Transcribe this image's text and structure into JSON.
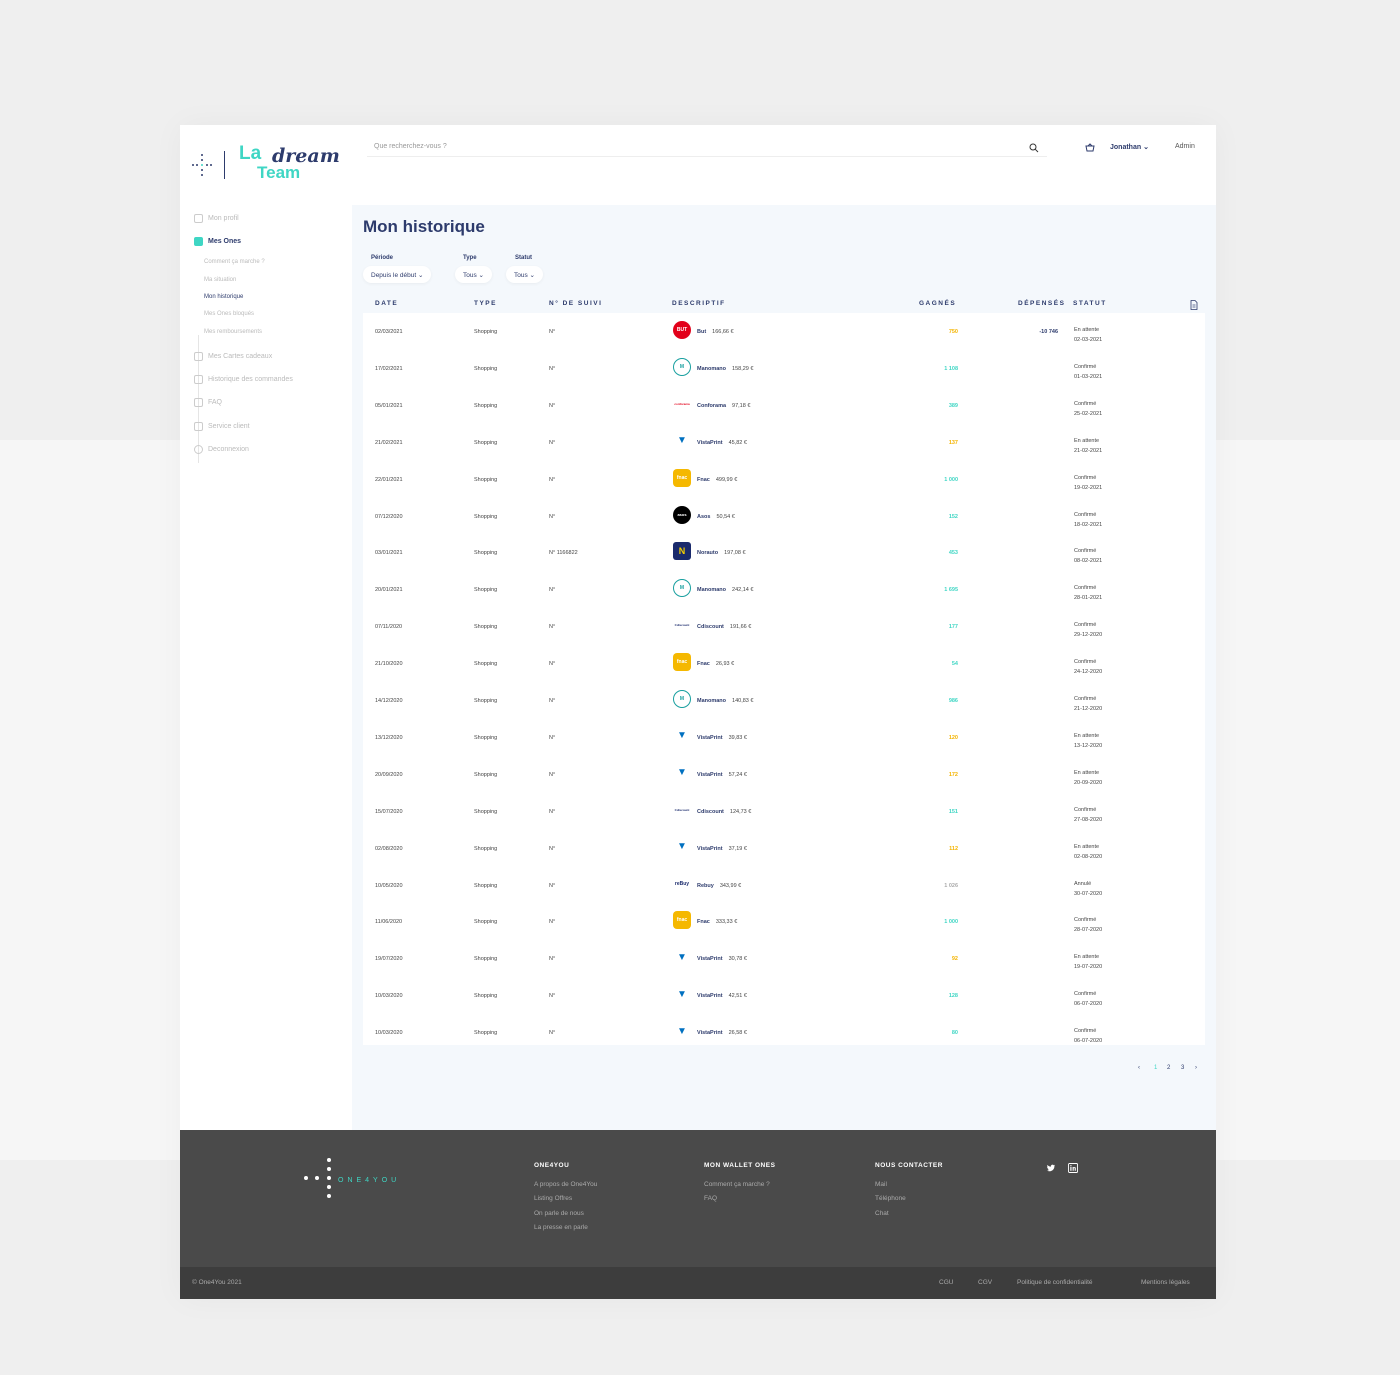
{
  "brand": {
    "la": "La",
    "dream": "dream",
    "team": "Team"
  },
  "header": {
    "search_placeholder": "Que recherchez-vous ?",
    "user": "Jonathan",
    "role": "Admin"
  },
  "sidebar": {
    "items": [
      {
        "label": "Mon profil",
        "icon": "profile-icon"
      },
      {
        "label": "Mes Ones",
        "icon": "coins-icon"
      },
      {
        "label": "Mes Cartes cadeaux",
        "icon": "gift-icon"
      },
      {
        "label": "Historique des commandes",
        "icon": "orders-icon"
      },
      {
        "label": "FAQ",
        "icon": "faq-icon"
      },
      {
        "label": "Service client",
        "icon": "support-icon"
      },
      {
        "label": "Deconnexion",
        "icon": "power-icon"
      }
    ],
    "subitems": [
      "Comment ça marche ?",
      "Ma situation",
      "Mon historique",
      "Mes Ones bloqués",
      "Mes remboursements"
    ]
  },
  "page": {
    "title": "Mon historique"
  },
  "filters": {
    "periode_label": "Période",
    "periode_value": "Depuis le début",
    "type_label": "Type",
    "type_value": "Tous",
    "statut_label": "Statut",
    "statut_value": "Tous"
  },
  "table": {
    "headers": {
      "date": "DATE",
      "type": "TYPE",
      "suivi": "N° DE SUIVI",
      "desc": "DESCRIPTIF",
      "gains": "GAGNÉS",
      "dep": "DÉPENSÉS",
      "statut": "STATUT"
    },
    "rows": [
      {
        "date": "02/03/2021",
        "type": "Shopping",
        "suivi": "N°",
        "merchant": "But",
        "amount": "166,66 €",
        "gain": "750",
        "dep": "-10 746",
        "status": "En attente",
        "sdate": "02-03-2021",
        "logo": "but",
        "gcolor": "#f4b400"
      },
      {
        "date": "17/02/2021",
        "type": "Shopping",
        "suivi": "N°",
        "merchant": "Manomano",
        "amount": "158,29 €",
        "gain": "1 108",
        "dep": "",
        "status": "Confirmé",
        "sdate": "01-03-2021",
        "logo": "mano",
        "gcolor": "#3fd6c4"
      },
      {
        "date": "05/01/2021",
        "type": "Shopping",
        "suivi": "N°",
        "merchant": "Conforama",
        "amount": "97,18 €",
        "gain": "389",
        "dep": "",
        "status": "Confirmé",
        "sdate": "25-02-2021",
        "logo": "confo",
        "gcolor": "#3fd6c4"
      },
      {
        "date": "21/02/2021",
        "type": "Shopping",
        "suivi": "N°",
        "merchant": "VistaPrint",
        "amount": "45,82 €",
        "gain": "137",
        "dep": "",
        "status": "En attente",
        "sdate": "21-02-2021",
        "logo": "vista",
        "gcolor": "#f4b400"
      },
      {
        "date": "22/01/2021",
        "type": "Shopping",
        "suivi": "N°",
        "merchant": "Fnac",
        "amount": "499,99 €",
        "gain": "1 000",
        "dep": "",
        "status": "Confirmé",
        "sdate": "19-02-2021",
        "logo": "fnac",
        "gcolor": "#3fd6c4"
      },
      {
        "date": "07/12/2020",
        "type": "Shopping",
        "suivi": "N°",
        "merchant": "Asos",
        "amount": "50,54 €",
        "gain": "152",
        "dep": "",
        "status": "Confirmé",
        "sdate": "18-02-2021",
        "logo": "asos",
        "gcolor": "#3fd6c4"
      },
      {
        "date": "03/01/2021",
        "type": "Shopping",
        "suivi": "N° 1166822",
        "merchant": "Norauto",
        "amount": "197,08 €",
        "gain": "453",
        "dep": "",
        "status": "Confirmé",
        "sdate": "08-02-2021",
        "logo": "nor",
        "gcolor": "#3fd6c4"
      },
      {
        "date": "20/01/2021",
        "type": "Shopping",
        "suivi": "N°",
        "merchant": "Manomano",
        "amount": "242,14 €",
        "gain": "1 695",
        "dep": "",
        "status": "Confirmé",
        "sdate": "28-01-2021",
        "logo": "mano",
        "gcolor": "#3fd6c4"
      },
      {
        "date": "07/11/2020",
        "type": "Shopping",
        "suivi": "N°",
        "merchant": "Cdiscount",
        "amount": "191,66 €",
        "gain": "177",
        "dep": "",
        "status": "Confirmé",
        "sdate": "29-12-2020",
        "logo": "cdis",
        "gcolor": "#3fd6c4"
      },
      {
        "date": "21/10/2020",
        "type": "Shopping",
        "suivi": "N°",
        "merchant": "Fnac",
        "amount": "26,93 €",
        "gain": "54",
        "dep": "",
        "status": "Confirmé",
        "sdate": "24-12-2020",
        "logo": "fnac",
        "gcolor": "#3fd6c4"
      },
      {
        "date": "14/12/2020",
        "type": "Shopping",
        "suivi": "N°",
        "merchant": "Manomano",
        "amount": "140,83 €",
        "gain": "986",
        "dep": "",
        "status": "Confirmé",
        "sdate": "21-12-2020",
        "logo": "mano",
        "gcolor": "#3fd6c4"
      },
      {
        "date": "13/12/2020",
        "type": "Shopping",
        "suivi": "N°",
        "merchant": "VistaPrint",
        "amount": "39,83 €",
        "gain": "120",
        "dep": "",
        "status": "En attente",
        "sdate": "13-12-2020",
        "logo": "vista",
        "gcolor": "#f4b400"
      },
      {
        "date": "20/09/2020",
        "type": "Shopping",
        "suivi": "N°",
        "merchant": "VistaPrint",
        "amount": "57,24 €",
        "gain": "172",
        "dep": "",
        "status": "En attente",
        "sdate": "20-09-2020",
        "logo": "vista",
        "gcolor": "#f4b400"
      },
      {
        "date": "15/07/2020",
        "type": "Shopping",
        "suivi": "N°",
        "merchant": "Cdiscount",
        "amount": "124,73 €",
        "gain": "151",
        "dep": "",
        "status": "Confirmé",
        "sdate": "27-08-2020",
        "logo": "cdis",
        "gcolor": "#3fd6c4"
      },
      {
        "date": "02/08/2020",
        "type": "Shopping",
        "suivi": "N°",
        "merchant": "VistaPrint",
        "amount": "37,19 €",
        "gain": "112",
        "dep": "",
        "status": "En attente",
        "sdate": "02-08-2020",
        "logo": "vista",
        "gcolor": "#f4b400"
      },
      {
        "date": "10/05/2020",
        "type": "Shopping",
        "suivi": "N°",
        "merchant": "Rebuy",
        "amount": "343,99 €",
        "gain": "1 026",
        "dep": "",
        "status": "Annulé",
        "sdate": "30-07-2020",
        "logo": "rebuy",
        "gcolor": "#aaaaaa"
      },
      {
        "date": "11/06/2020",
        "type": "Shopping",
        "suivi": "N°",
        "merchant": "Fnac",
        "amount": "333,33 €",
        "gain": "1 000",
        "dep": "",
        "status": "Confirmé",
        "sdate": "28-07-2020",
        "logo": "fnac",
        "gcolor": "#3fd6c4"
      },
      {
        "date": "19/07/2020",
        "type": "Shopping",
        "suivi": "N°",
        "merchant": "VistaPrint",
        "amount": "30,78 €",
        "gain": "92",
        "dep": "",
        "status": "En attente",
        "sdate": "19-07-2020",
        "logo": "vista",
        "gcolor": "#f4b400"
      },
      {
        "date": "10/03/2020",
        "type": "Shopping",
        "suivi": "N°",
        "merchant": "VistaPrint",
        "amount": "42,51 €",
        "gain": "128",
        "dep": "",
        "status": "Confirmé",
        "sdate": "06-07-2020",
        "logo": "vista",
        "gcolor": "#3fd6c4"
      },
      {
        "date": "10/03/2020",
        "type": "Shopping",
        "suivi": "N°",
        "merchant": "VistaPrint",
        "amount": "26,58 €",
        "gain": "80",
        "dep": "",
        "status": "Confirmé",
        "sdate": "06-07-2020",
        "logo": "vista",
        "gcolor": "#3fd6c4"
      }
    ]
  },
  "pagination": {
    "prev": "‹",
    "pages": [
      "1",
      "2",
      "3"
    ],
    "next": "›"
  },
  "footer": {
    "logo_text": "ONE4YOU",
    "col1_title": "ONE4YOU",
    "col1": [
      "A propos de One4You",
      "Listing Offres",
      "On parle de nous",
      "La presse en parle"
    ],
    "col2_title": "MON WALLET ONES",
    "col2": [
      "Comment ça marche ?",
      "FAQ"
    ],
    "col3_title": "NOUS CONTACTER",
    "col3": [
      "Mail",
      "Téléphone",
      "Chat"
    ],
    "copyright": "© One4You 2021",
    "legal": [
      "CGU",
      "CGV",
      "Politique de confidentialité",
      "Mentions légales"
    ]
  },
  "colors": {
    "navy": "#2d3b6c",
    "teal": "#3fd6c4",
    "orange": "#f4b400"
  }
}
